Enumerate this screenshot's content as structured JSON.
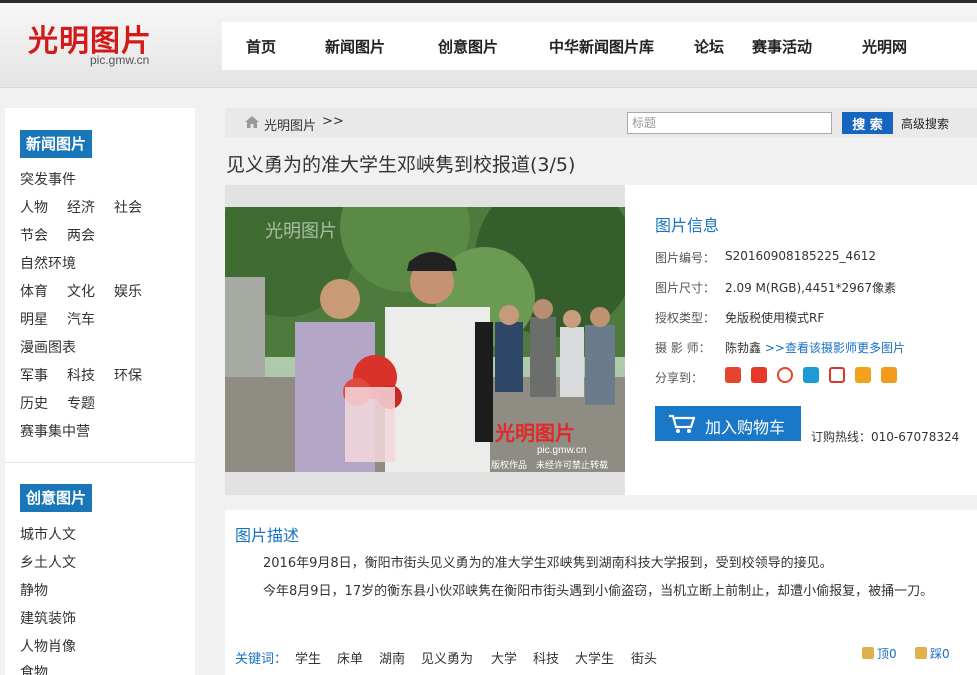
{
  "header": {
    "logo_text": "光明图片",
    "logo_url": "pic.gmw.cn",
    "nav": [
      "首页",
      "新闻图片",
      "创意图片",
      "中华新闻图片库",
      "论坛",
      "赛事活动",
      "光明网"
    ]
  },
  "sidebar": {
    "news_title": "新闻图片",
    "news_items": [
      "突发事件",
      "人物",
      "经济",
      "社会",
      "节会",
      "两会",
      "自然环境",
      "体育",
      "文化",
      "娱乐",
      "明星",
      "汽车",
      "漫画图表",
      "军事",
      "科技",
      "环保",
      "历史",
      "专题",
      "赛事集中营"
    ],
    "creative_title": "创意图片",
    "creative_items": [
      "城市人文",
      "乡土人文",
      "静物",
      "建筑装饰",
      "人物肖像",
      "食物"
    ]
  },
  "breadcrumb": {
    "home_label": "光明图片",
    "separator": ">>"
  },
  "search": {
    "placeholder": "标题",
    "button_label": "搜 索",
    "advanced_label": "高级搜索"
  },
  "page_title": "见义勇为的准大学生邓峡隽到校报道(3/5)",
  "photo": {
    "watermark_text": "光明图片",
    "watermark_url": "pic.gmw.cn",
    "copyright_text": "版权作品　未经许可禁止转载"
  },
  "info": {
    "title": "图片信息",
    "rows": [
      {
        "label": "图片编号：",
        "value": "S20160908185225_4612"
      },
      {
        "label": "图片尺寸：",
        "value": "2.09 M(RGB),4451*2967像素"
      },
      {
        "label": "授权类型：",
        "value": "免版税使用模式RF"
      },
      {
        "label": "摄 影 师：",
        "value": "陈勃鑫",
        "link": ">>查看该摄影师更多图片"
      }
    ],
    "share_label": "分享到：",
    "share_icons": [
      {
        "name": "google-share-icon",
        "color": "#e5452f"
      },
      {
        "name": "fetion-share-icon",
        "color": "#e8382a"
      },
      {
        "name": "weibo-share-icon",
        "color": "#e6442e"
      },
      {
        "name": "qzone-share-icon",
        "color": "#1e9ad6"
      },
      {
        "name": "renren-share-icon",
        "color": "#d7372c"
      },
      {
        "name": "kaixin-share-icon",
        "color": "#f0a21b"
      },
      {
        "name": "douban-share-icon",
        "color": "#f39a1d"
      }
    ],
    "cart_label": "加入购物车",
    "hotline": "订购热线：010-67078324"
  },
  "description": {
    "title": "图片描述",
    "paragraphs": [
      "2016年9月8日，衡阳市街头见义勇为的准大学生邓峡隽到湖南科技大学报到，受到校领导的接见。",
      "今年8月9日，17岁的衡东县小伙邓峡隽在衡阳市街头遇到小偷盗窃，当机立断上前制止，却遭小偷报复，被捅一刀。"
    ],
    "keywords_label": "关键词：",
    "keywords": [
      "学生",
      "床单",
      "湖南",
      "见义勇为",
      "大学",
      "科技",
      "大学生",
      "街头"
    ],
    "up_label": "顶0",
    "down_label": "踩0"
  },
  "colors": {
    "accent_blue": "#1976b8",
    "logo_red": "#d11b1b"
  }
}
